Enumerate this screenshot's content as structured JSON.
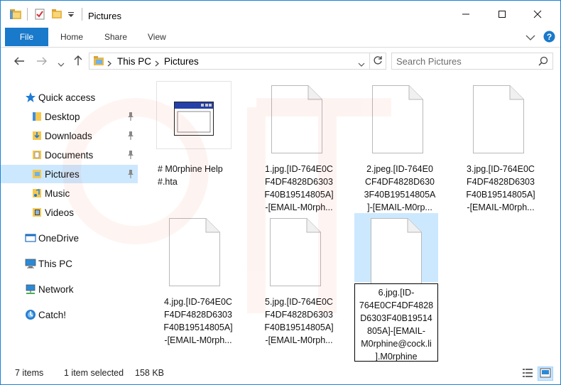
{
  "window": {
    "title": "Pictures",
    "accent_color": "#1979ca"
  },
  "ribbon": {
    "tabs": [
      {
        "label": "File"
      },
      {
        "label": "Home"
      },
      {
        "label": "Share"
      },
      {
        "label": "View"
      }
    ]
  },
  "address_bar": {
    "breadcrumb": [
      "This PC",
      "Pictures"
    ]
  },
  "search": {
    "placeholder": "Search Pictures"
  },
  "sidebar": {
    "items": [
      {
        "label": "Quick access",
        "icon": "star-icon"
      },
      {
        "label": "Desktop",
        "icon": "desktop-folder-icon",
        "pinned": true
      },
      {
        "label": "Downloads",
        "icon": "downloads-folder-icon",
        "pinned": true
      },
      {
        "label": "Documents",
        "icon": "documents-folder-icon",
        "pinned": true
      },
      {
        "label": "Pictures",
        "icon": "pictures-folder-icon",
        "pinned": true,
        "selected": true
      },
      {
        "label": "Music",
        "icon": "music-folder-icon"
      },
      {
        "label": "Videos",
        "icon": "videos-folder-icon"
      },
      {
        "label": "OneDrive",
        "icon": "onedrive-icon"
      },
      {
        "label": "This PC",
        "icon": "this-pc-icon"
      },
      {
        "label": "Network",
        "icon": "network-icon"
      },
      {
        "label": "Catch!",
        "icon": "catch-icon"
      }
    ]
  },
  "files": [
    {
      "name": "# M0rphine Help\n#.hta",
      "icon": "hta-window-icon"
    },
    {
      "name": "1.jpg.[ID-764E0C\nF4DF4828D6303\nF40B19514805A]\n-[EMAIL-M0rph...",
      "icon": "blank-file-icon"
    },
    {
      "name": "2.jpeg.[ID-764E0\nCF4DF4828D630\n3F40B19514805A\n]-[EMAIL-M0rp...",
      "icon": "blank-file-icon"
    },
    {
      "name": "3.jpg.[ID-764E0C\nF4DF4828D6303\nF40B19514805A]\n-[EMAIL-M0rph...",
      "icon": "blank-file-icon"
    },
    {
      "name": "4.jpg.[ID-764E0C\nF4DF4828D6303\nF40B19514805A]\n-[EMAIL-M0rph...",
      "icon": "blank-file-icon"
    },
    {
      "name": "5.jpg.[ID-764E0C\nF4DF4828D6303\nF40B19514805A]\n-[EMAIL-M0rph...",
      "icon": "blank-file-icon"
    },
    {
      "name": "6.jpg.[ID-\n764E0CF4DF4828\nD6303F40B19514\n805A]-[EMAIL-\nM0rphine@cock.li\n].M0rphine",
      "icon": "blank-file-icon",
      "selected": true
    }
  ],
  "status": {
    "item_count": "7 items",
    "selection": "1 item selected",
    "size": "158 KB"
  }
}
